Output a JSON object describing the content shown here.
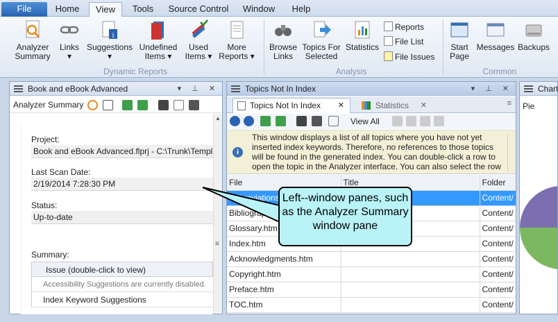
{
  "menu": {
    "tabs": [
      "File",
      "Home",
      "View",
      "Tools",
      "Source Control",
      "Window",
      "Help"
    ]
  },
  "ribbon": {
    "analyzer_summary": "Analyzer Summary",
    "links": "Links",
    "suggestions": "Suggestions",
    "undefined_items": "Undefined Items",
    "used_items": "Used Items",
    "more_reports": "More Reports",
    "browse_links": "Browse Links",
    "topics_for_selected": "Topics For Selected",
    "statistics": "Statistics",
    "reports": "Reports",
    "file_list": "File List",
    "file_issues": "File Issues",
    "start_page": "Start Page",
    "messages": "Messages",
    "backups": "Backups",
    "group_dynamic_reports": "Dynamic Reports",
    "group_analysis": "Analysis",
    "group_common": "Common"
  },
  "left_pane": {
    "title": "Book and eBook Advanced",
    "toolbar_label": "Analyzer Summary",
    "project_label": "Project:",
    "project_value": "Book and eBook Advanced.flprj - C:\\Trunk\\Templates\\",
    "last_scan_label": "Last Scan Date:",
    "last_scan_value": "2/19/2014 7:28:30 PM",
    "status_label": "Status:",
    "status_value": "Up-to-date",
    "summary_label": "Summary:",
    "summary_header": "Issue (double-click to view)",
    "summary_rows": [
      "Accessibility Suggestions are currently disabled.",
      "Index Keyword Suggestions"
    ]
  },
  "center_pane": {
    "title": "Topics Not In Index",
    "tab1": "Topics Not In Index",
    "tab2": "Statistics",
    "view_all": "View All",
    "info_text": "This window displays a list of all topics where you have not yet inserted index keywords. Therefore, no references to those topics will be found in the generated index. You can double-click a row to open the topic in the Analyzer interface. You can also select the row",
    "columns": [
      "File",
      "Title",
      "Folder"
    ],
    "rows": [
      {
        "file": "Abbreviations.htm",
        "title": "",
        "folder": "Content/"
      },
      {
        "file": "Bibliography.htm",
        "title": "",
        "folder": "Content/"
      },
      {
        "file": "Glossary.htm",
        "title": "",
        "folder": "Content/"
      },
      {
        "file": "Index.htm",
        "title": "",
        "folder": "Content/"
      },
      {
        "file": "Acknowledgments.htm",
        "title": "",
        "folder": "Content/"
      },
      {
        "file": "Copyright.htm",
        "title": "",
        "folder": "Content/"
      },
      {
        "file": "Preface.htm",
        "title": "",
        "folder": "Content/"
      },
      {
        "file": "TOC.htm",
        "title": "",
        "folder": "Content/"
      }
    ]
  },
  "right_pane": {
    "title": "Chart",
    "subtitle": "Pie"
  },
  "callout": {
    "text": "Left--window panes, such as the Analyzer Summary window pane"
  },
  "colors": {
    "accent": "#2a63b1",
    "callout_bg": "#b9f3f8",
    "selected_row": "#3399ff",
    "pie_purple": "#7c6fb0",
    "pie_green": "#7cb860"
  }
}
